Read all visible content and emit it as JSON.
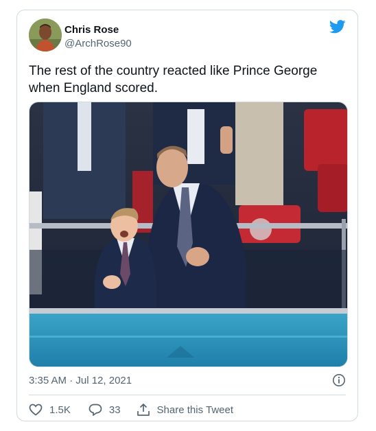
{
  "author": {
    "name": "Chris Rose",
    "handle": "@ArchRose90"
  },
  "tweet": {
    "text": "The rest of the country reacted like Prince George when England scored.",
    "timestamp": "3:35 AM · Jul 12, 2021"
  },
  "stats": {
    "likes": "1.5K",
    "replies": "33",
    "share_label": "Share this Tweet"
  },
  "icons": {
    "brand": "twitter-bird-icon",
    "info": "info-icon",
    "like": "heart-icon",
    "reply": "speech-bubble-icon",
    "share": "share-icon"
  },
  "colors": {
    "brand": "#1d9bf0",
    "secondary_text": "#536471",
    "border": "#cfd9de"
  }
}
